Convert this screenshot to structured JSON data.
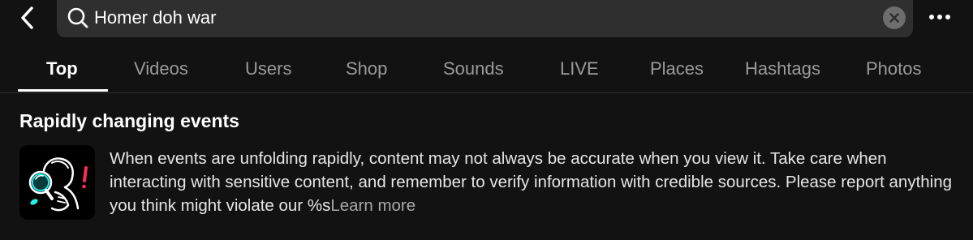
{
  "header": {
    "back_icon": "chevron-left-icon",
    "search": {
      "icon": "search-icon",
      "value": "Homer doh war",
      "clear_icon": "clear-x-icon"
    },
    "more_icon": "more-horizontal-icon"
  },
  "tabs": [
    {
      "label": "Top",
      "active": true
    },
    {
      "label": "Videos",
      "active": false
    },
    {
      "label": "Users",
      "active": false
    },
    {
      "label": "Shop",
      "active": false
    },
    {
      "label": "Sounds",
      "active": false
    },
    {
      "label": "LIVE",
      "active": false
    },
    {
      "label": "Places",
      "active": false
    },
    {
      "label": "Hashtags",
      "active": false
    },
    {
      "label": "Photos",
      "active": false
    }
  ],
  "notice": {
    "title": "Rapidly changing events",
    "illustration_icon": "magnifier-alert-illustration",
    "body": "When events are unfolding rapidly, content may not always be accurate when you view it. Take care when interacting with sensitive content, and remember to verify information with credible sources. Please report anything you think might violate our %s",
    "link": "Learn more"
  },
  "colors": {
    "background": "#121212",
    "search_bg": "#2f2f2f",
    "tab_inactive": "#9a9a9a",
    "tab_active": "#ffffff",
    "accent_red": "#fe2c55",
    "illustration_teal": "#25f4ee"
  }
}
